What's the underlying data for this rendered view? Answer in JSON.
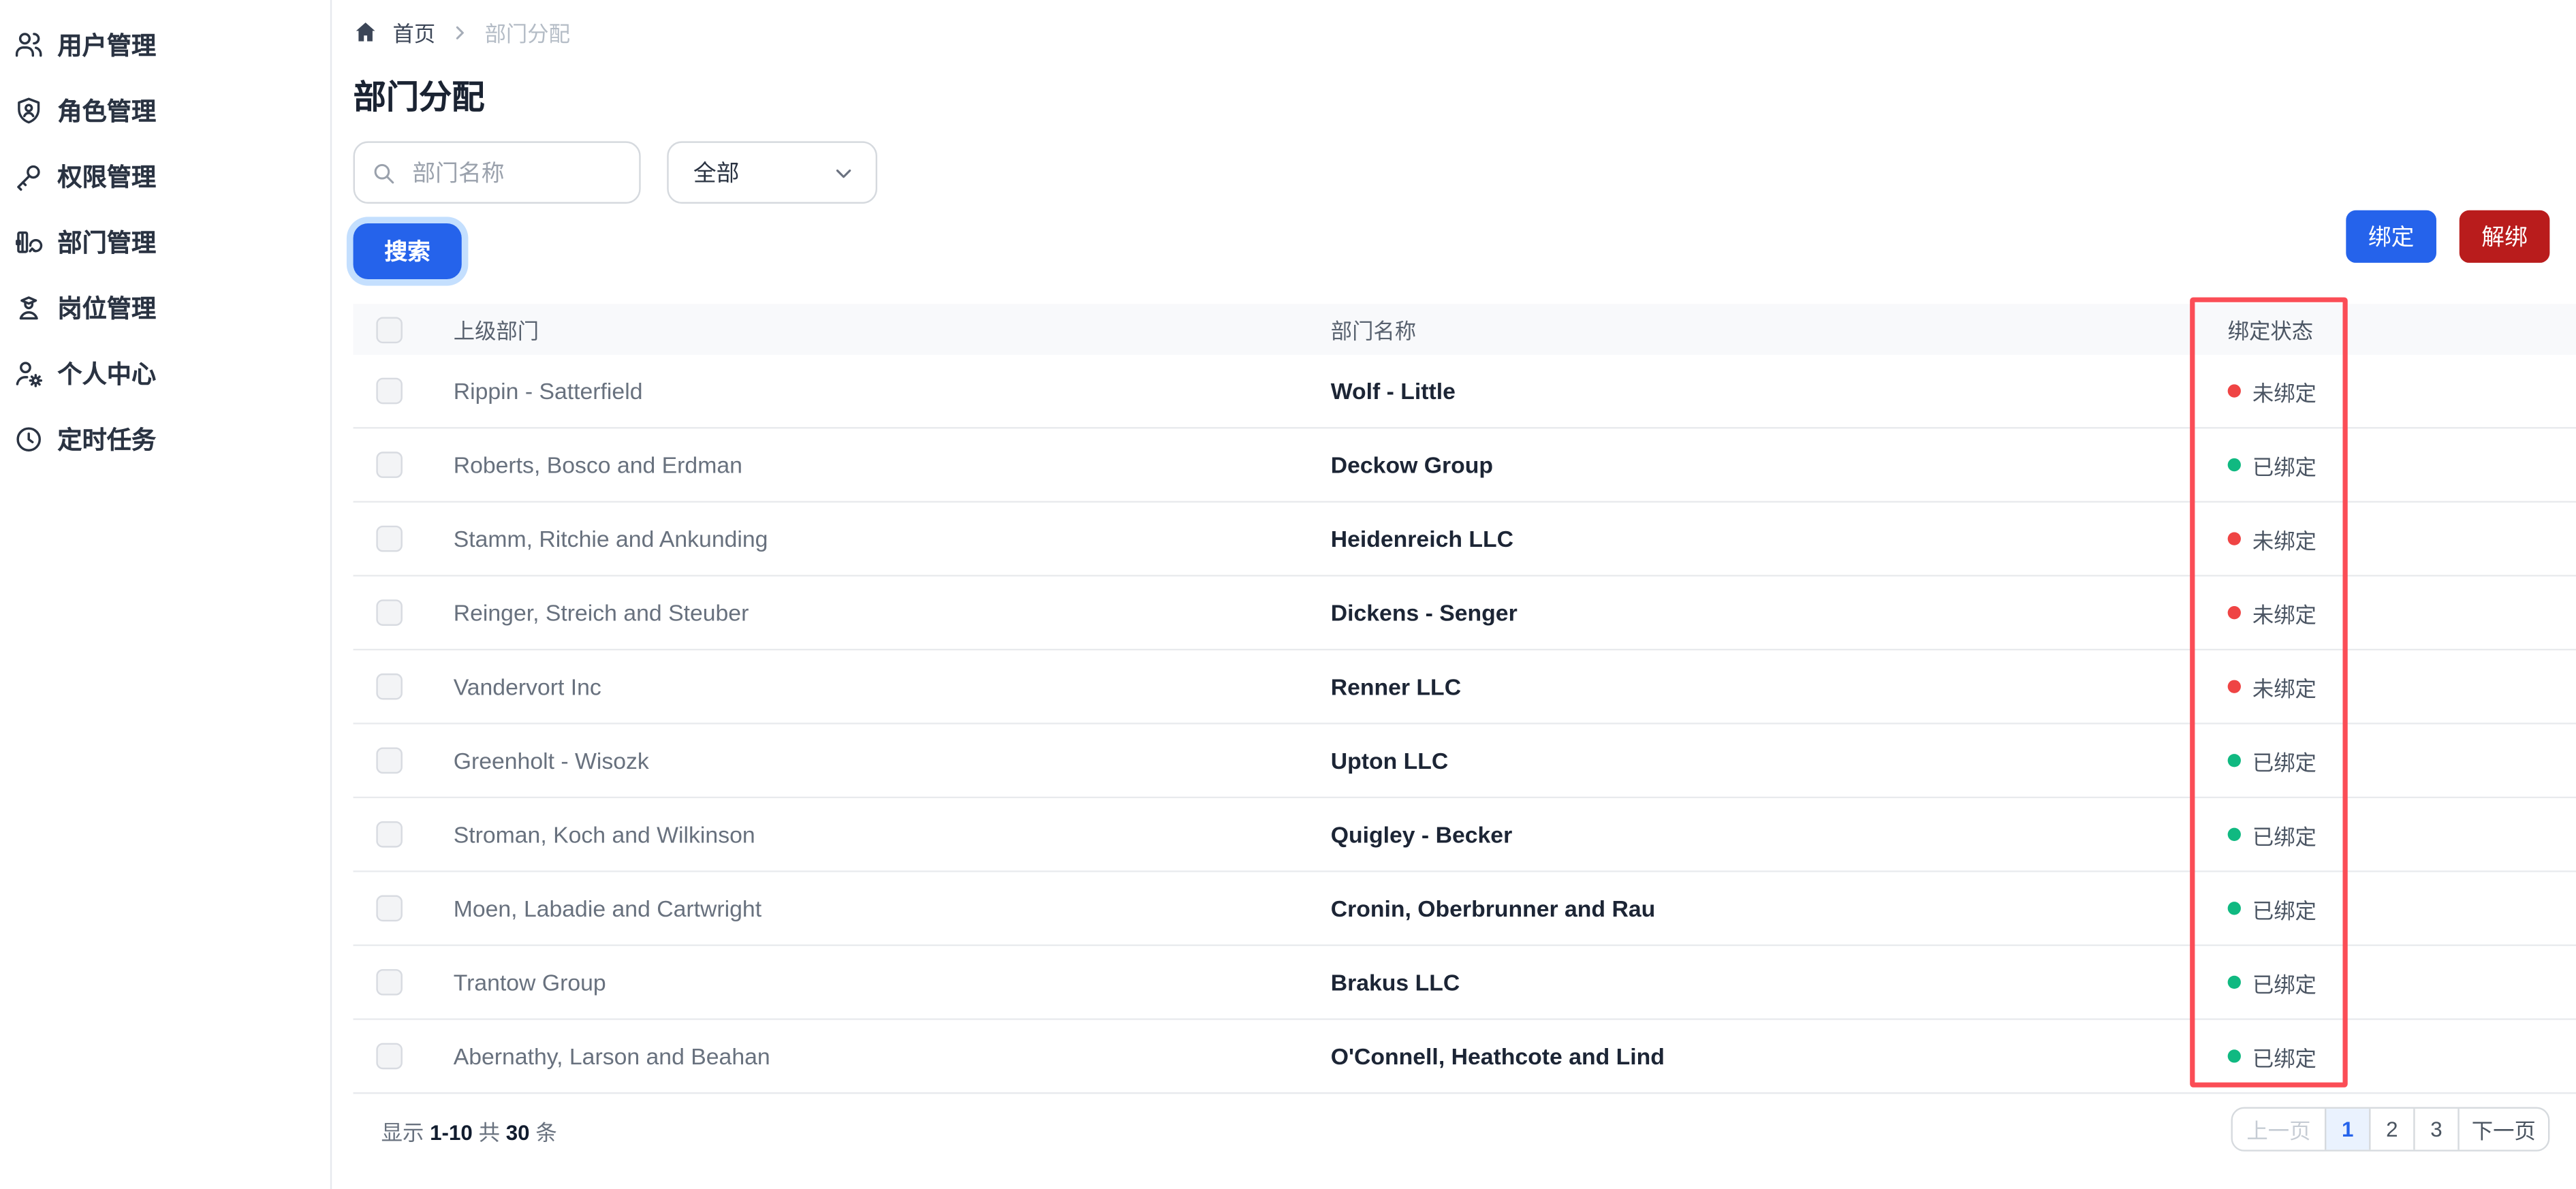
{
  "sidebar": {
    "items": [
      {
        "label": "用户管理",
        "icon": "users-icon"
      },
      {
        "label": "角色管理",
        "icon": "shield-user-icon"
      },
      {
        "label": "权限管理",
        "icon": "key-icon"
      },
      {
        "label": "部门管理",
        "icon": "department-icon"
      },
      {
        "label": "岗位管理",
        "icon": "position-icon"
      },
      {
        "label": "个人中心",
        "icon": "user-gear-icon"
      },
      {
        "label": "定时任务",
        "icon": "clock-icon"
      }
    ]
  },
  "breadcrumb": {
    "root": "首页",
    "current": "部门分配"
  },
  "page": {
    "title": "部门分配"
  },
  "filters": {
    "search_placeholder": "部门名称",
    "search_value": "",
    "status_value": "全部",
    "search_button": "搜索"
  },
  "actions": {
    "bind": "绑定",
    "unbind": "解绑"
  },
  "table": {
    "headers": {
      "parent": "上级部门",
      "name": "部门名称",
      "status": "绑定状态"
    },
    "rows": [
      {
        "parent": "Rippin - Satterfield",
        "name": "Wolf - Little",
        "status": "未绑定",
        "status_color": "#ef4444"
      },
      {
        "parent": "Roberts, Bosco and Erdman",
        "name": "Deckow Group",
        "status": "已绑定",
        "status_color": "#10b981"
      },
      {
        "parent": "Stamm, Ritchie and Ankunding",
        "name": "Heidenreich LLC",
        "status": "未绑定",
        "status_color": "#ef4444"
      },
      {
        "parent": "Reinger, Streich and Steuber",
        "name": "Dickens - Senger",
        "status": "未绑定",
        "status_color": "#ef4444"
      },
      {
        "parent": "Vandervort Inc",
        "name": "Renner LLC",
        "status": "未绑定",
        "status_color": "#ef4444"
      },
      {
        "parent": "Greenholt - Wisozk",
        "name": "Upton LLC",
        "status": "已绑定",
        "status_color": "#10b981"
      },
      {
        "parent": "Stroman, Koch and Wilkinson",
        "name": "Quigley - Becker",
        "status": "已绑定",
        "status_color": "#10b981"
      },
      {
        "parent": "Moen, Labadie and Cartwright",
        "name": "Cronin, Oberbrunner and Rau",
        "status": "已绑定",
        "status_color": "#10b981"
      },
      {
        "parent": "Trantow Group",
        "name": "Brakus LLC",
        "status": "已绑定",
        "status_color": "#10b981"
      },
      {
        "parent": "Abernathy, Larson and Beahan",
        "name": "O'Connell, Heathcote and Lind",
        "status": "已绑定",
        "status_color": "#10b981"
      }
    ]
  },
  "pagination": {
    "summary": {
      "show": "显示",
      "range": "1-10",
      "total_label": "共",
      "total": "30",
      "unit": "条"
    },
    "prev": "上一页",
    "pages": [
      "1",
      "2",
      "3"
    ],
    "active_page": "1",
    "next": "下一页"
  },
  "colors": {
    "primary_blue": "#2563eb",
    "danger_red": "#b91c1c",
    "status_unbound_dot": "#ef4444",
    "status_bound_dot": "#10b981",
    "highlight_box": "#fb4d56",
    "header_bg": "#f8f9fb"
  }
}
